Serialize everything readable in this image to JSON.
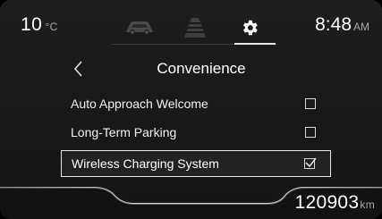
{
  "status": {
    "temperature": "10",
    "temperature_unit": "°C",
    "time": "8:48",
    "ampm": "AM"
  },
  "tabs": [
    {
      "icon": "car-icon",
      "active": false
    },
    {
      "icon": "lane-road-icon",
      "active": false
    },
    {
      "icon": "gear-icon",
      "active": true
    }
  ],
  "header": {
    "title": "Convenience",
    "back_icon": "chevron-left-icon"
  },
  "menu": {
    "items": [
      {
        "label": "Auto Approach Welcome",
        "checked": false,
        "selected": false
      },
      {
        "label": "Long-Term Parking",
        "checked": false,
        "selected": false
      },
      {
        "label": "Wireless Charging System",
        "checked": true,
        "selected": true
      }
    ]
  },
  "odometer": {
    "value": "120903",
    "unit": "km"
  },
  "colors": {
    "background": "#1a1a1a",
    "text": "#ffffff",
    "muted": "#aaaaaa",
    "icon_inactive": "#4a4a4a",
    "icon_active": "#ffffff"
  }
}
